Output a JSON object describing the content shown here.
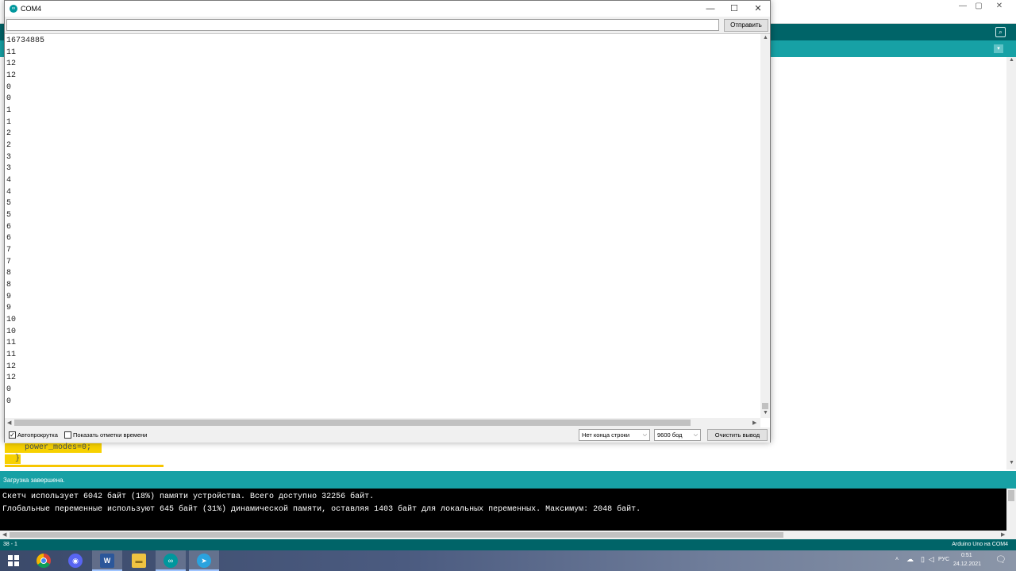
{
  "ide": {
    "window_controls": {
      "minimize": "—",
      "maximize": "▢",
      "close": "✕"
    },
    "code_lines": [
      "power_modes=0;",
      "}"
    ],
    "status": "Загрузка завершена.",
    "console": [
      "Скетч использует 6042 байт (18%) памяти устройства. Всего доступно 32256 байт.",
      "Глобальные переменные используют 645 байт (31%) динамической памяти, оставляя 1403 байт для локальных переменных. Максимум: 2048 байт."
    ],
    "line_indicator": "38 - 1",
    "board_info": "Arduino Uno на COM4"
  },
  "serial": {
    "title": "COM4",
    "window_controls": {
      "minimize": "—",
      "maximize": "☐",
      "close": "✕"
    },
    "input_value": "",
    "send_label": "Отправить",
    "output": [
      "16734885",
      "11",
      "12",
      "12",
      "0",
      "0",
      "1",
      "1",
      "2",
      "2",
      "3",
      "3",
      "4",
      "4",
      "5",
      "5",
      "6",
      "6",
      "7",
      "7",
      "8",
      "8",
      "9",
      "9",
      "10",
      "10",
      "11",
      "11",
      "12",
      "12",
      "0",
      "0"
    ],
    "autoscroll_label": "Автопрокрутка",
    "autoscroll_checked": true,
    "timestamp_label": "Показать отметки времени",
    "timestamp_checked": false,
    "line_ending": "Нет конца строки",
    "baud": "9600 бод",
    "clear_label": "Очистить вывод"
  },
  "taskbar": {
    "apps": [
      "windows-start",
      "chrome",
      "discord",
      "word",
      "file-explorer",
      "arduino",
      "telegram"
    ],
    "language": "РУС",
    "time": "0:51",
    "date": "24.12.2021"
  },
  "colors": {
    "arduino_dark": "#006468",
    "arduino_teal": "#17a1a5",
    "highlight": "#f7d101"
  }
}
